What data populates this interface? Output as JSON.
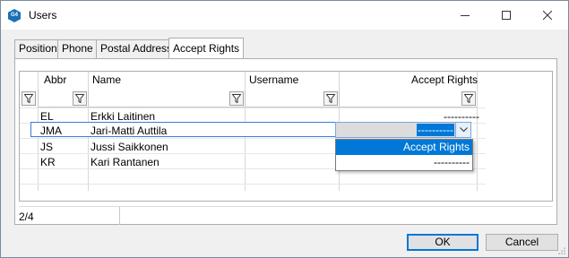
{
  "window": {
    "title": "Users",
    "app_icon_text": "G4"
  },
  "tabs": [
    {
      "label": "Position"
    },
    {
      "label": "Phone"
    },
    {
      "label": "Postal Address"
    },
    {
      "label": "Accept Rights"
    }
  ],
  "active_tab": "Accept Rights",
  "grid": {
    "columns": [
      "Abbr",
      "Name",
      "Username",
      "Accept Rights"
    ],
    "rows": [
      {
        "abbr": "EL",
        "name": "Erkki Laitinen",
        "username": "",
        "accept_rights": "----------"
      },
      {
        "abbr": "JMA",
        "name": "Jari-Matti Auttila",
        "username": "",
        "accept_rights": "----------"
      },
      {
        "abbr": "JS",
        "name": "Jussi Saikkonen",
        "username": "",
        "accept_rights": ""
      },
      {
        "abbr": "KR",
        "name": "Kari Rantanen",
        "username": "",
        "accept_rights": ""
      }
    ],
    "selected_row": 1
  },
  "dropdown": {
    "selected_value": "----------",
    "options": [
      "Accept Rights",
      "----------"
    ],
    "highlighted": "Accept Rights"
  },
  "status": {
    "record_position": "2/4"
  },
  "buttons": {
    "ok": "OK",
    "cancel": "Cancel"
  },
  "colors": {
    "selection": "#0078d7",
    "accent_icon": "#1b6fb5"
  }
}
